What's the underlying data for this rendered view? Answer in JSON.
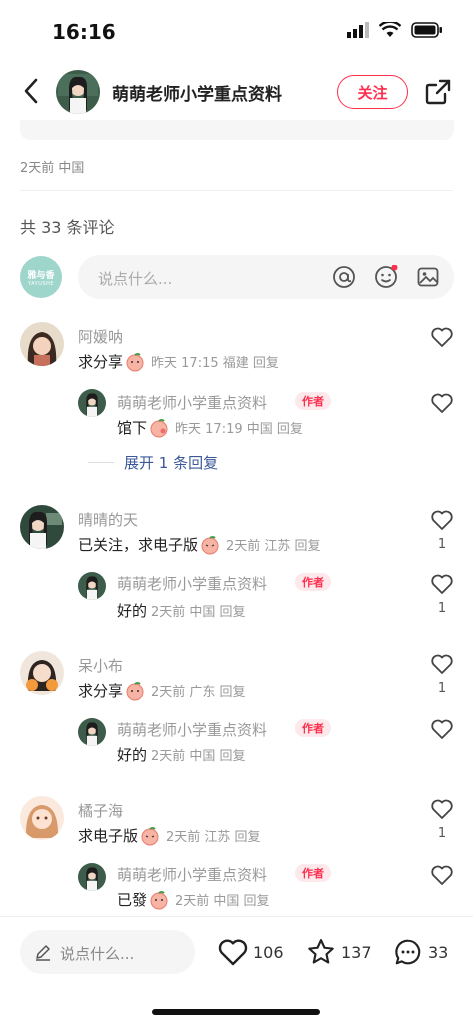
{
  "status": {
    "time": "16:16"
  },
  "header": {
    "title": "萌萌老师小学重点资料",
    "follow_label": "关注"
  },
  "post": {
    "meta": "2天前 中国"
  },
  "comments_header": {
    "count_text": "共 33 条评论"
  },
  "input": {
    "placeholder": "说点什么...",
    "avatar_text_1": "雅与香",
    "avatar_text_2": "YAYUSHE"
  },
  "comments": [
    {
      "user": "阿媛呐",
      "text": "求分享",
      "meta": "昨天 17:15 福建 回复",
      "reply": {
        "user": "萌萌老师小学重点资料",
        "tag": "作者",
        "text": "馆下",
        "meta": "昨天 17:19 中国 回复",
        "likes": ""
      },
      "likes": "",
      "expand": "展开 1 条回复"
    },
    {
      "user": "晴晴的天",
      "text": "已关注，求电子版",
      "meta": "2天前 江苏 回复",
      "reply": {
        "user": "萌萌老师小学重点资料",
        "tag": "作者",
        "text": "好的",
        "meta": "2天前 中国 回复",
        "likes": "1"
      },
      "likes": "1"
    },
    {
      "user": "呆小布",
      "text": "求分享",
      "meta": "2天前 广东 回复",
      "reply": {
        "user": "萌萌老师小学重点资料",
        "tag": "作者",
        "text": "好的",
        "meta": "2天前 中国 回复",
        "likes": ""
      },
      "likes": "1"
    },
    {
      "user": "橘子海",
      "text": "求电子版",
      "meta": "2天前 江苏 回复",
      "reply": {
        "user": "萌萌老师小学重点资料",
        "tag": "作者",
        "text": "已發",
        "meta": "2天前 中国 回复",
        "likes": ""
      },
      "likes": "1"
    }
  ],
  "bottom": {
    "placeholder": "说点什么...",
    "likes": "106",
    "stars": "137",
    "comments": "33"
  },
  "colors": {
    "accent": "#ff2e4d",
    "link": "#3b5898"
  }
}
